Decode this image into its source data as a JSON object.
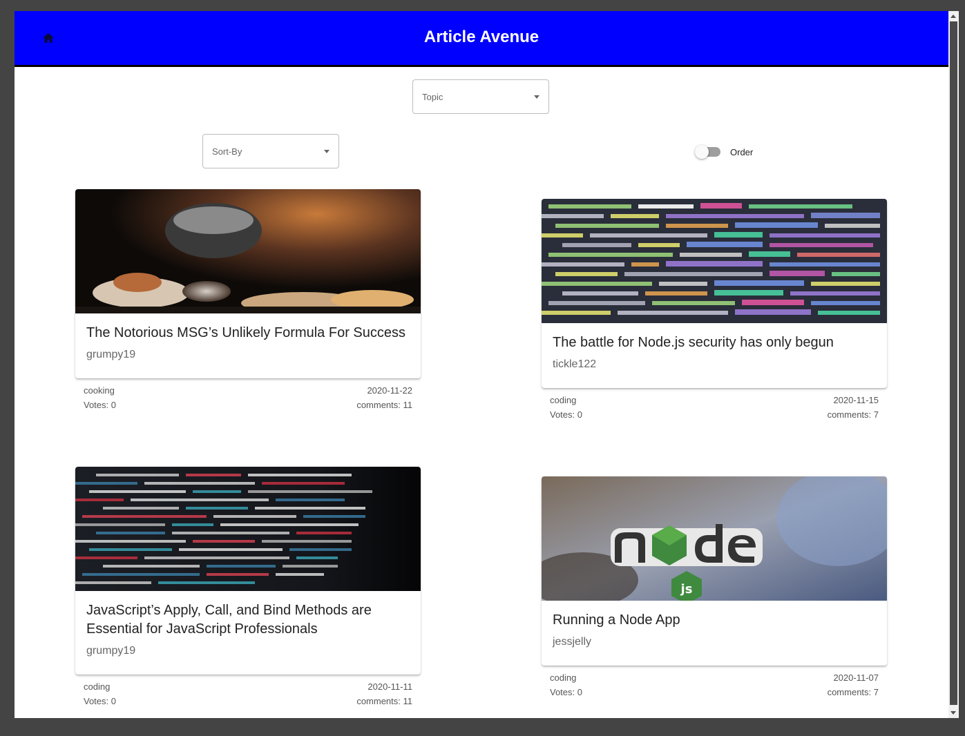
{
  "app": {
    "title": "Article Avenue",
    "brand_color": "#0000ff",
    "home_icon": "home-icon"
  },
  "filters": {
    "topic_label": "Topic",
    "sort_label": "Sort-By",
    "order_label": "Order",
    "order_on": false
  },
  "articles": [
    {
      "title": "The Notorious MSG’s Unlikely Formula For Success",
      "author": "grumpy19",
      "topic": "cooking",
      "date": "2020-11-22",
      "votes": "Votes: 0",
      "comments": "comments: 11",
      "image": "cooking-photo"
    },
    {
      "title": "The battle for Node.js security has only begun",
      "author": "tickle122",
      "topic": "coding",
      "date": "2020-11-15",
      "votes": "Votes: 0",
      "comments": "comments: 7",
      "image": "code-screen-photo"
    },
    {
      "title": "JavaScript’s Apply, Call, and Bind Methods are Essential for JavaScript Professionals",
      "author": "grumpy19",
      "topic": "coding",
      "date": "2020-11-11",
      "votes": "Votes: 0",
      "comments": "comments: 11",
      "image": "code-screen-dark-photo"
    },
    {
      "title": "Running a Node App",
      "author": "jessjelly",
      "topic": "coding",
      "date": "2020-11-07",
      "votes": "Votes: 0",
      "comments": "comments: 7",
      "image": "node-sticker-photo"
    }
  ]
}
